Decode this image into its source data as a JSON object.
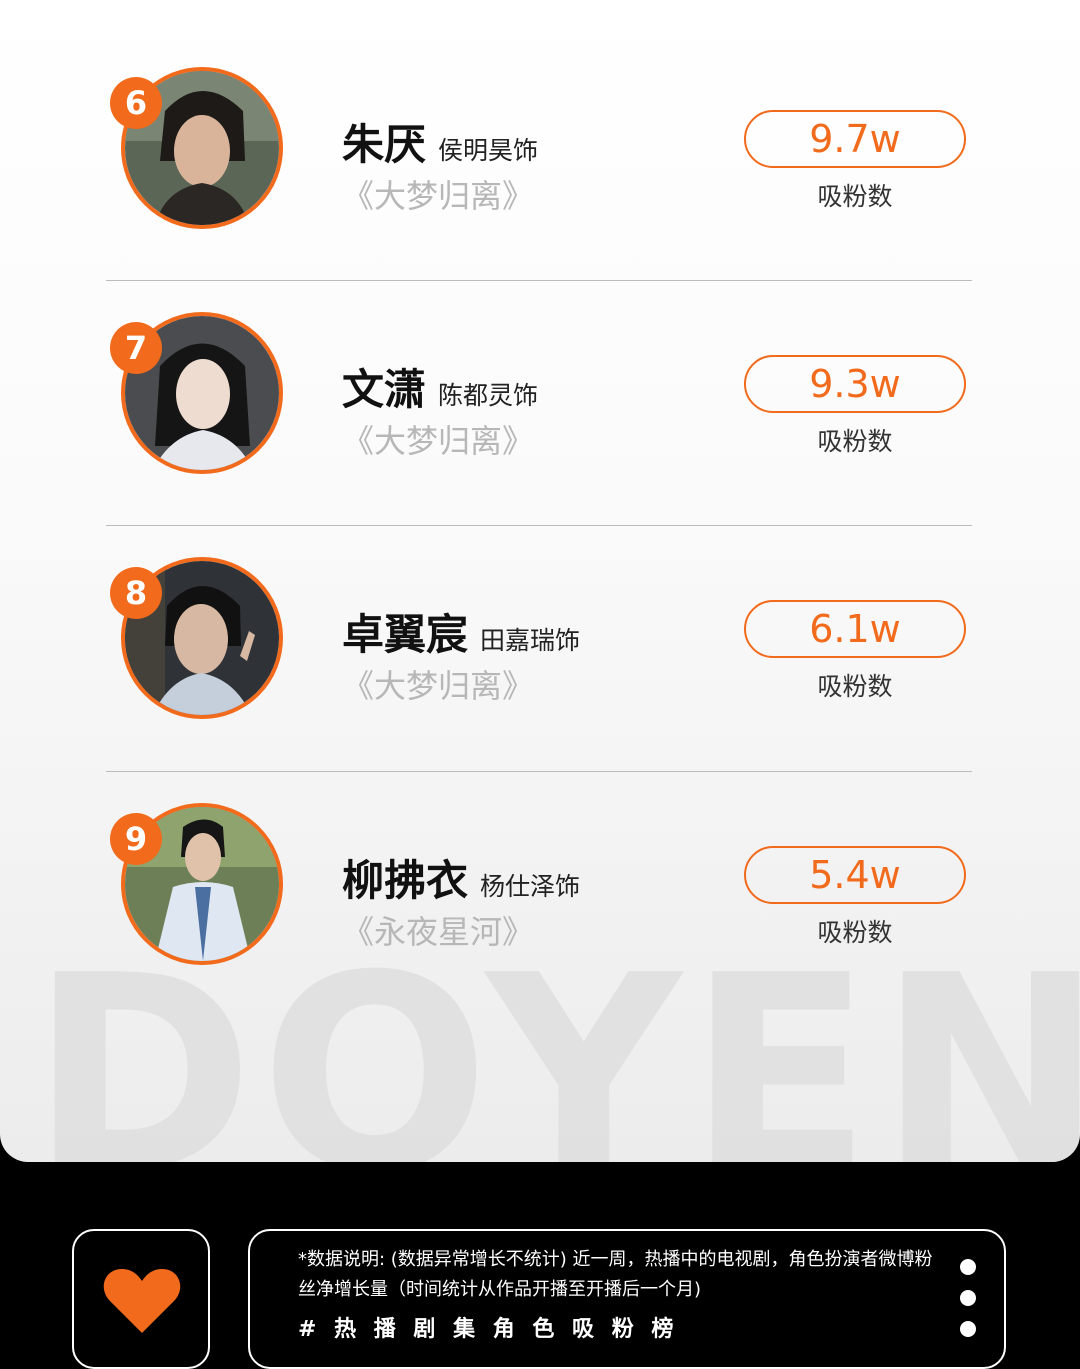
{
  "watermark": "DOYEN",
  "colors": {
    "accent": "#f26a1b",
    "footer_bg": "#000000"
  },
  "entries": [
    {
      "rank": "6",
      "role": "朱厌",
      "actor": "侯明昊饰",
      "show": "《大梦归离》",
      "fans": "9.7w",
      "fans_label": "吸粉数"
    },
    {
      "rank": "7",
      "role": "文潇",
      "actor": "陈都灵饰",
      "show": "《大梦归离》",
      "fans": "9.3w",
      "fans_label": "吸粉数"
    },
    {
      "rank": "8",
      "role": "卓翼宸",
      "actor": "田嘉瑞饰",
      "show": "《大梦归离》",
      "fans": "6.1w",
      "fans_label": "吸粉数"
    },
    {
      "rank": "9",
      "role": "柳拂衣",
      "actor": "杨仕泽饰",
      "show": "《永夜星河》",
      "fans": "5.4w",
      "fans_label": "吸粉数"
    }
  ],
  "footer": {
    "icon": "heart-icon",
    "note": "*数据说明: (数据异常增长不统计) 近一周，热播中的电视剧，角色扮演者微博粉丝净增长量（时间统计从作品开播至开播后一个月)",
    "tag": "# 热 播 剧 集 角 色 吸 粉 榜",
    "menu_icon": "more-vertical-icon"
  }
}
